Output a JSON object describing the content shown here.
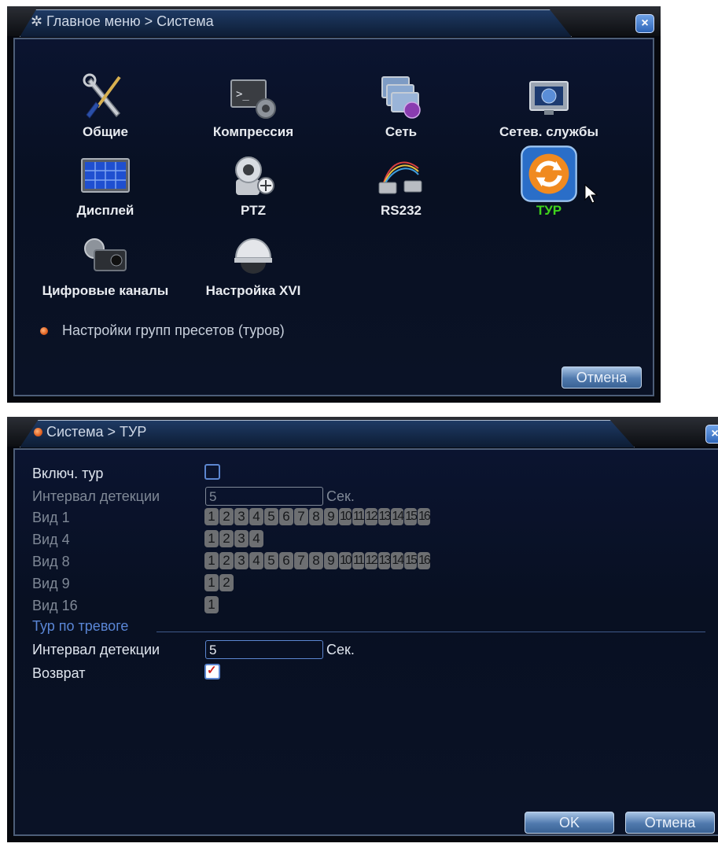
{
  "window1": {
    "title": "Главное меню > Система",
    "close_label": "×",
    "menu_items": [
      {
        "label": "Общие",
        "icon": "tools-icon"
      },
      {
        "label": "Компрессия",
        "icon": "terminal-gear-icon"
      },
      {
        "label": "Сеть",
        "icon": "network-icon"
      },
      {
        "label": "Сетев. службы",
        "icon": "globe-monitor-icon"
      },
      {
        "label": "Дисплей",
        "icon": "display-grid-icon"
      },
      {
        "label": "PTZ",
        "icon": "ptz-camera-icon"
      },
      {
        "label": "RS232",
        "icon": "serial-cable-icon"
      },
      {
        "label": "ТУР",
        "icon": "tour-refresh-icon"
      },
      {
        "label": "Цифровые каналы",
        "icon": "digital-camera-icon"
      },
      {
        "label": "Настройка XVI",
        "icon": "dome-camera-icon"
      }
    ],
    "hint": "Настройки групп пресетов (туров)",
    "cancel_label": "Отмена"
  },
  "window2": {
    "title": "Система > ТУР",
    "close_label": "×",
    "enable_tour_label": "Включ. тур",
    "interval_label": "Интервал детекции",
    "interval_value": "5",
    "unit": "Сек.",
    "views": [
      {
        "label": "Вид 1",
        "channels": [
          "1",
          "2",
          "3",
          "4",
          "5",
          "6",
          "7",
          "8",
          "9",
          "10",
          "11",
          "12",
          "13",
          "14",
          "15",
          "16"
        ]
      },
      {
        "label": "Вид 4",
        "channels": [
          "1",
          "2",
          "3",
          "4"
        ]
      },
      {
        "label": "Вид 8",
        "channels": [
          "1",
          "2",
          "3",
          "4",
          "5",
          "6",
          "7",
          "8",
          "9",
          "10",
          "11",
          "12",
          "13",
          "14",
          "15",
          "16"
        ]
      },
      {
        "label": "Вид 9",
        "channels": [
          "1",
          "2"
        ]
      },
      {
        "label": "Вид 16",
        "channels": [
          "1"
        ]
      }
    ],
    "alarm_section": "Тур по тревоге",
    "alarm_interval_label": "Интервал детекции",
    "alarm_interval_value": "5",
    "alarm_unit": "Сек.",
    "return_label": "Возврат",
    "return_checked": true,
    "ok_label": "OK",
    "cancel_label": "Отмена"
  },
  "colors": {
    "active_label": "#3fd21c",
    "section_title": "#5a86d6",
    "panel_bg": "#081022"
  }
}
